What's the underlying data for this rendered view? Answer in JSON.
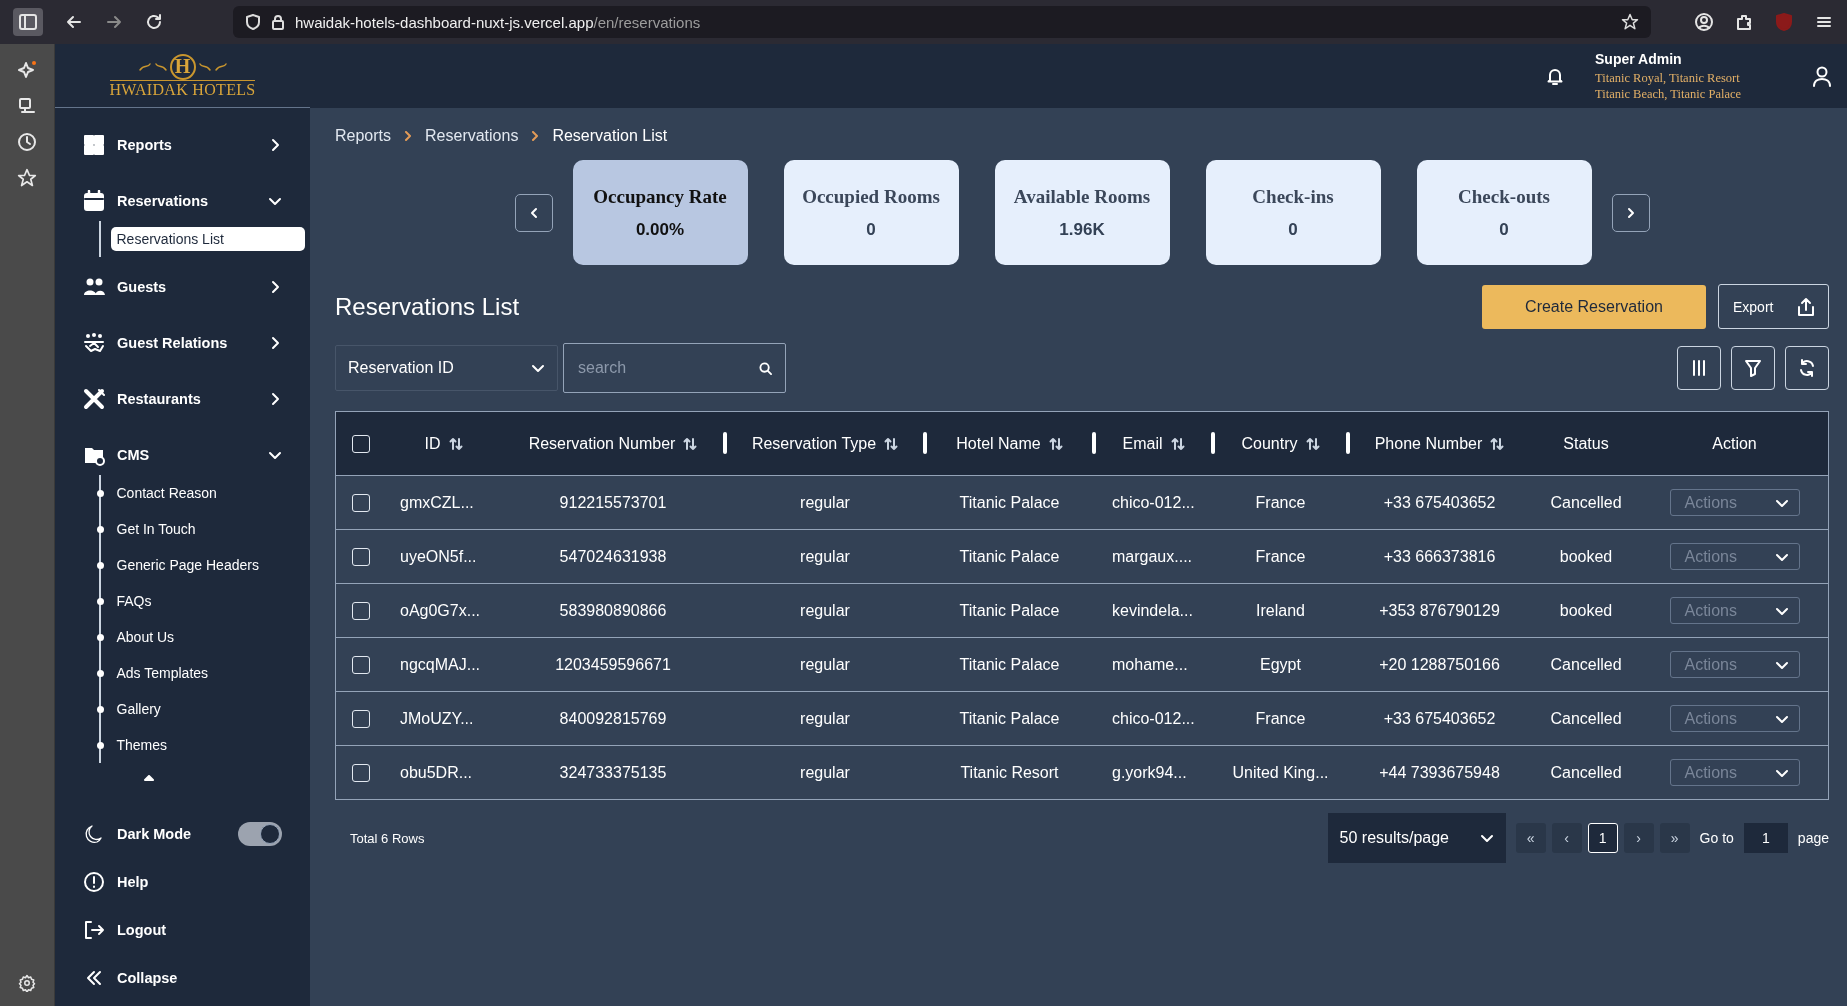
{
  "browser": {
    "url_host": "hwaidak-hotels-dashboard-nuxt-js.vercel.app",
    "url_path": "/en/reservations"
  },
  "logo": {
    "letter": "H",
    "name": "HWAIDAK HOTELS"
  },
  "user": {
    "name": "Super Admin",
    "hotels": [
      "Titanic Royal, Titanic Resort",
      "Titanic Beach, Titanic Palace"
    ]
  },
  "sidebar": {
    "items": [
      {
        "label": "Reports",
        "expanded": false
      },
      {
        "label": "Reservations",
        "expanded": true,
        "children": [
          {
            "label": "Reservations List",
            "selected": true
          }
        ]
      },
      {
        "label": "Guests",
        "expanded": false
      },
      {
        "label": "Guest Relations",
        "expanded": false
      },
      {
        "label": "Restaurants",
        "expanded": false
      },
      {
        "label": "CMS",
        "expanded": true,
        "children": [
          {
            "label": "Contact Reason",
            "selected": false
          },
          {
            "label": "Get In Touch",
            "selected": false
          },
          {
            "label": "Generic Page Headers",
            "selected": false
          },
          {
            "label": "FAQs",
            "selected": false
          },
          {
            "label": "About Us",
            "selected": false
          },
          {
            "label": "Ads Templates",
            "selected": false
          },
          {
            "label": "Gallery",
            "selected": false
          },
          {
            "label": "Themes",
            "selected": false
          }
        ]
      }
    ],
    "dark_mode": {
      "label": "Dark Mode",
      "on": true
    },
    "bottom": [
      "Help",
      "Logout",
      "Collapse"
    ]
  },
  "breadcrumb": [
    "Reports",
    "Reservations",
    "Reservation List"
  ],
  "stats": [
    {
      "title": "Occupancy Rate",
      "value": "0.00%",
      "selected": true
    },
    {
      "title": "Occupied Rooms",
      "value": "0",
      "selected": false
    },
    {
      "title": "Available Rooms",
      "value": "1.96K",
      "selected": false
    },
    {
      "title": "Check-ins",
      "value": "0",
      "selected": false
    },
    {
      "title": "Check-outs",
      "value": "0",
      "selected": false
    }
  ],
  "page_title": "Reservations List",
  "buttons": {
    "create": "Create Reservation",
    "export": "Export"
  },
  "filter": {
    "field": "Reservation ID",
    "placeholder": "search"
  },
  "table": {
    "columns": [
      {
        "label": "ID",
        "sortable": true,
        "resizable": false
      },
      {
        "label": "Reservation Number",
        "sortable": true,
        "resizable": true
      },
      {
        "label": "Reservation Type",
        "sortable": true,
        "resizable": true
      },
      {
        "label": "Hotel Name",
        "sortable": true,
        "resizable": true
      },
      {
        "label": "Email",
        "sortable": true,
        "resizable": true
      },
      {
        "label": "Country",
        "sortable": true,
        "resizable": true
      },
      {
        "label": "Phone Number",
        "sortable": true,
        "resizable": false
      },
      {
        "label": "Status",
        "sortable": false,
        "resizable": false
      },
      {
        "label": "Action",
        "sortable": false,
        "resizable": false
      }
    ],
    "rows": [
      {
        "checked": false,
        "cells": [
          "gmxCZL...",
          "912215573701",
          "regular",
          "Titanic Palace",
          "chico-012...",
          "France",
          "+33 675403652",
          "Cancelled"
        ],
        "action": "Actions"
      },
      {
        "checked": false,
        "cells": [
          "uyeON5f...",
          "547024631938",
          "regular",
          "Titanic Palace",
          "margaux....",
          "France",
          "+33 666373816",
          "booked"
        ],
        "action": "Actions"
      },
      {
        "checked": false,
        "cells": [
          "oAg0G7x...",
          "583980890866",
          "regular",
          "Titanic Palace",
          "kevindela...",
          "Ireland",
          "+353 876790129",
          "booked"
        ],
        "action": "Actions"
      },
      {
        "checked": false,
        "cells": [
          "ngcqMAJ...",
          "1203459596671",
          "regular",
          "Titanic Palace",
          "mohame...",
          "Egypt",
          "+20 1288750166",
          "Cancelled"
        ],
        "action": "Actions"
      },
      {
        "checked": false,
        "cells": [
          "JMoUZY...",
          "840092815769",
          "regular",
          "Titanic Palace",
          "chico-012...",
          "France",
          "+33 675403652",
          "Cancelled"
        ],
        "action": "Actions"
      },
      {
        "checked": false,
        "cells": [
          "obu5DR...",
          "324733375135",
          "regular",
          "Titanic Resort",
          "g.york94...",
          "United King...",
          "+44 7393675948",
          "Cancelled"
        ],
        "action": "Actions"
      }
    ],
    "select_all_checked": false
  },
  "footer": {
    "total": "Total 6 Rows",
    "page_size": "50 results/page",
    "nav": [
      "«",
      "‹",
      "›",
      "»"
    ],
    "pages": [
      {
        "label": "1",
        "selected": true
      }
    ],
    "goto_label": "Go to",
    "goto_value": "1",
    "page_label": "page"
  }
}
